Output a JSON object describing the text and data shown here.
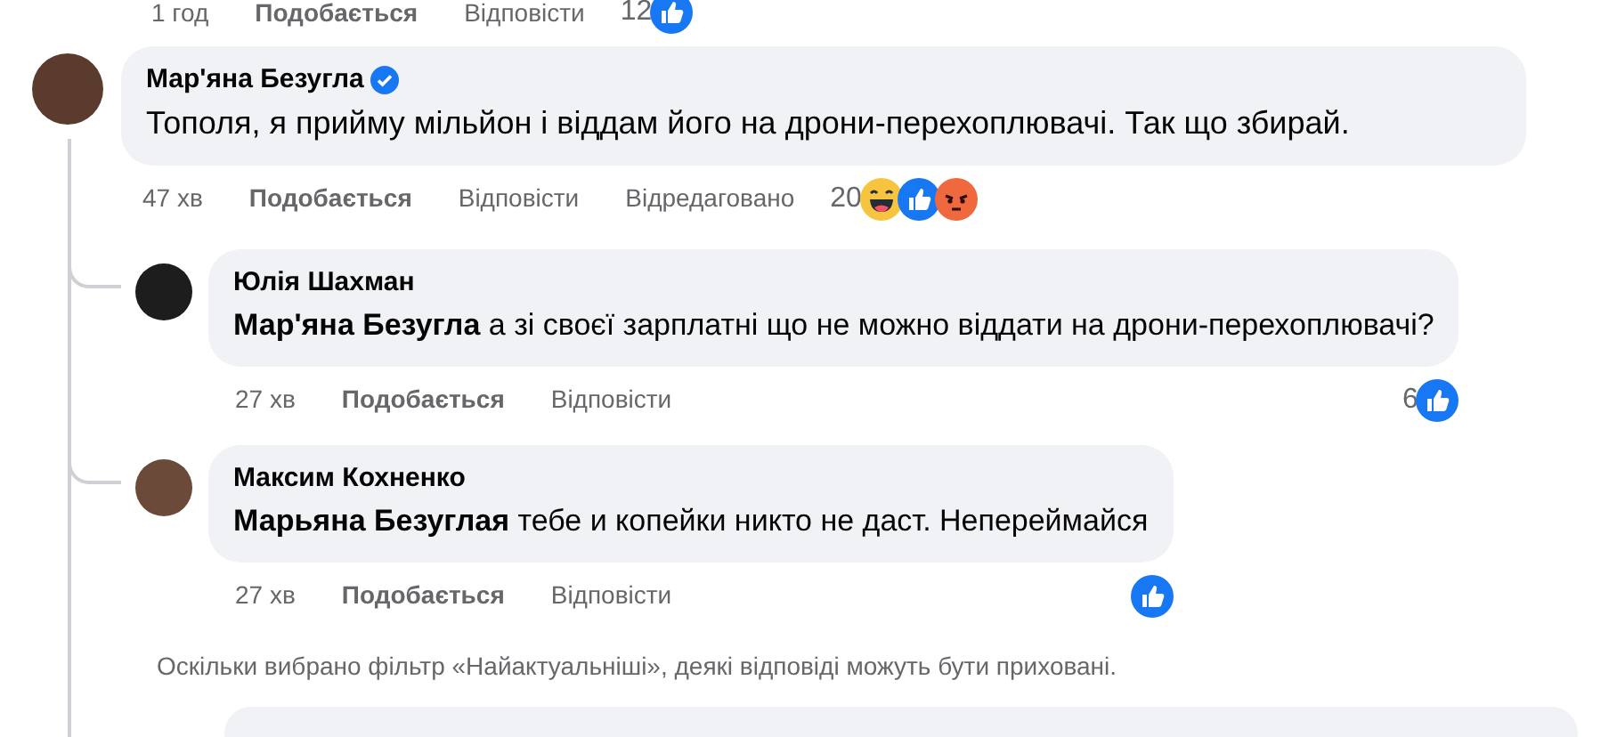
{
  "previous_meta": {
    "time": "1 год",
    "like_label": "Подобається",
    "reply_label": "Відповісти",
    "reaction_count": "12",
    "reactions": [
      {
        "kind": "like"
      }
    ]
  },
  "comment": {
    "author": "Мар'яна Безугла",
    "verified": true,
    "text": "Тополя, я прийму мільйон і віддам його на дрони-перехоплювачі. Так що збирай.",
    "time": "47 хв",
    "like_label": "Подобається",
    "reply_label": "Відповісти",
    "edited_label": "Відредаговано",
    "reaction_count": "20",
    "reactions": [
      {
        "kind": "haha"
      },
      {
        "kind": "like"
      },
      {
        "kind": "angry"
      }
    ]
  },
  "replies": [
    {
      "author": "Юлія Шахман",
      "text": "**Мар'яна Безугла** а зі своєї зарплатні що не можно віддати на дрони-перехоплювачі?",
      "time": "27 хв",
      "like_label": "Подобається",
      "reply_label": "Відповісти",
      "reaction_count": "6",
      "reactions": [
        {
          "kind": "like"
        }
      ]
    },
    {
      "author": "Максим Кохненко",
      "text": "**Марьяна Безуглая** тебе и копейки никто не даст. Непереймайся",
      "time": "27 хв",
      "like_label": "Подобається",
      "reply_label": "Відповісти",
      "reactions": [
        {
          "kind": "like"
        }
      ]
    }
  ],
  "filter_note": "Оскільки вибрано фільтр «Найактуальніші», деякі відповіді можуть бути приховані."
}
